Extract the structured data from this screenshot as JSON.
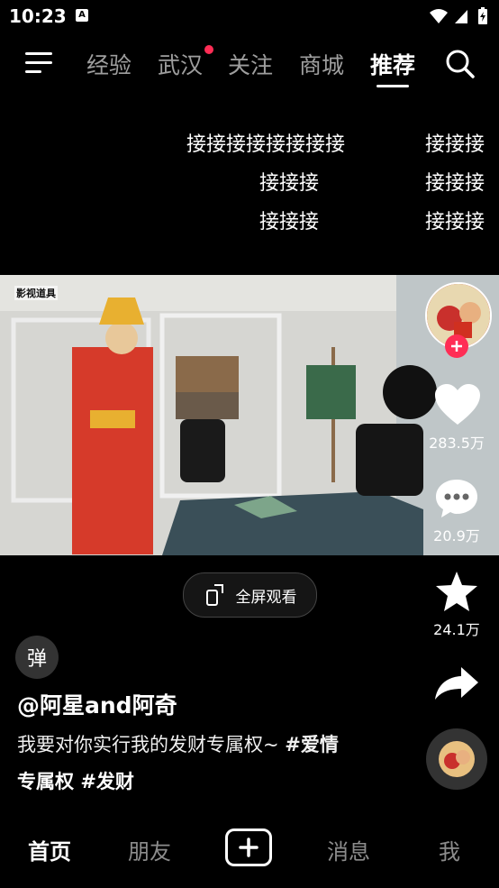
{
  "status_bar": {
    "time": "10:23",
    "app_badge": "A"
  },
  "nav": {
    "menu_icon": "menu-icon",
    "tabs": [
      "经验",
      "武汉",
      "关注",
      "商城",
      "推荐"
    ],
    "active_tab": "推荐",
    "search_icon": "search-icon",
    "accent": "#ff2d55"
  },
  "danmaku": [
    {
      "text": "接接接接接接接接"
    },
    {
      "text": "接接接"
    },
    {
      "text": "接接接"
    },
    {
      "text": "接接接"
    },
    {
      "text": "接接接"
    },
    {
      "text": "接接接"
    }
  ],
  "video": {
    "watermark": "影视道具"
  },
  "actions": {
    "like_count": "283.5万",
    "comment_count": "20.9万",
    "favorite_count": "24.1万"
  },
  "fullscreen_label": "全屏观看",
  "danmaku_toggle": "弹",
  "post": {
    "author": "@阿星and阿奇",
    "caption_line1_text": "我要对你实行我的发财专属权~ ",
    "caption_line1_tag": "#爱情",
    "caption_line2_tag1": "专属权",
    "caption_line2_tag2": "#发财"
  },
  "bottom_nav": {
    "home": "首页",
    "friends": "朋友",
    "messages": "消息",
    "me": "我"
  }
}
